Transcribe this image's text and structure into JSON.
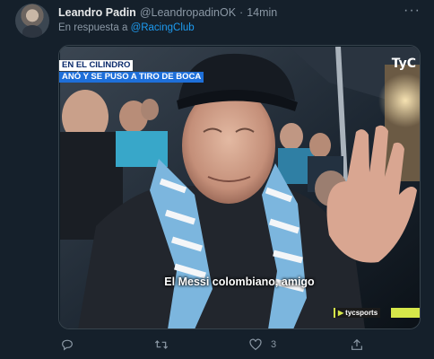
{
  "tweet": {
    "author_name": "Leandro Padin",
    "author_handle": "@LeandropadinOK",
    "separator": "·",
    "time": "14min",
    "reply_prefix": "En respuesta a",
    "reply_mention": "@RacingClub",
    "more_label": "···"
  },
  "media": {
    "chyron_line1": "EN EL CILINDRO",
    "chyron_line2": "ANÓ Y SE PUSO A TIRO DE BOCA",
    "brand": "TyC",
    "subtitle": "El Messi colombiano, amigo",
    "badge_text": "tycsports",
    "badge_icon": "▶"
  },
  "actions": {
    "reply_count": "",
    "retweet_count": "",
    "like_count": "3"
  },
  "colors": {
    "background": "#15202b",
    "muted": "#8b98a5",
    "accent": "#1d9bf0",
    "badge_accent": "#d6e84a"
  },
  "icons": [
    "reply-icon",
    "retweet-icon",
    "like-icon",
    "share-icon",
    "more-icon"
  ]
}
